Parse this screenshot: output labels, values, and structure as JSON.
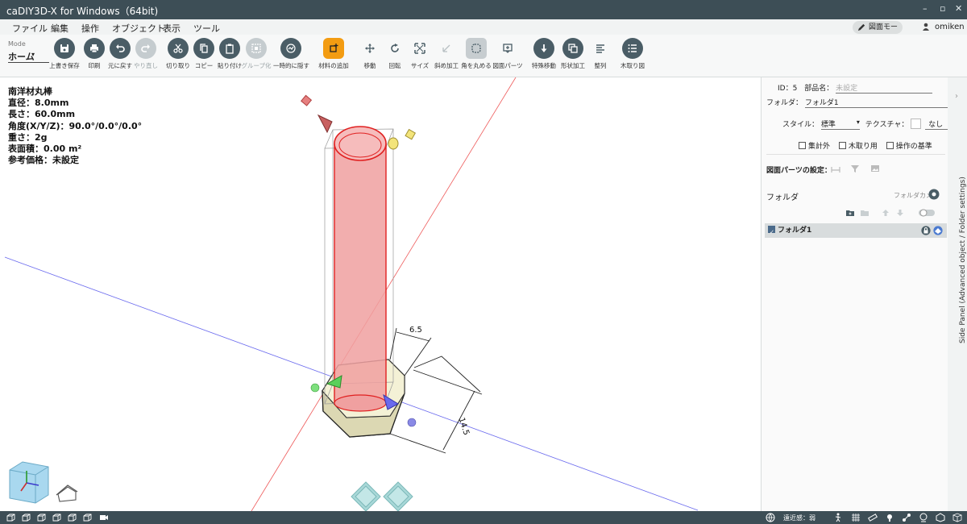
{
  "window": {
    "title": "caDIY3D-X for Windows（64bit)",
    "minimize": "–",
    "maximize": "▫",
    "close": "✕"
  },
  "menu": {
    "items": [
      "ファイル",
      "編集",
      "操作",
      "オブジェクト",
      "表示",
      "ツール"
    ]
  },
  "header_right": {
    "mode_button": "図面モード",
    "user": "omiken"
  },
  "toolbar": {
    "mode_label": "Mode",
    "mode_value": "ホーム",
    "tools": [
      {
        "label": "上書き保存",
        "icon": "save-icon",
        "enabled": true
      },
      {
        "label": "印刷",
        "icon": "print-icon",
        "enabled": true
      },
      {
        "label": "元に戻す",
        "icon": "undo-icon",
        "enabled": true
      },
      {
        "label": "やり直し",
        "icon": "redo-icon",
        "enabled": false
      },
      {
        "label": "切り取り",
        "icon": "cut-icon",
        "enabled": true
      },
      {
        "label": "コピー",
        "icon": "copy-icon",
        "enabled": true
      },
      {
        "label": "貼り付け",
        "icon": "paste-icon",
        "enabled": true
      },
      {
        "label": "グループ化",
        "icon": "group-icon",
        "enabled": false
      },
      {
        "label": "一時的に隠す",
        "icon": "hide-icon",
        "enabled": true
      },
      {
        "label": "材料の追加",
        "icon": "add-material-icon",
        "enabled": true
      },
      {
        "label": "移動",
        "icon": "move-icon",
        "enabled": true
      },
      {
        "label": "回転",
        "icon": "rotate-icon",
        "enabled": true
      },
      {
        "label": "サイズ",
        "icon": "resize-icon",
        "enabled": true
      },
      {
        "label": "斜め加工",
        "icon": "bevel-icon",
        "enabled": false
      },
      {
        "label": "角を丸める",
        "icon": "round-corner-icon",
        "enabled": true
      },
      {
        "label": "図面パーツ",
        "icon": "drawing-parts-icon",
        "enabled": true
      },
      {
        "label": "特殊移動",
        "icon": "special-move-icon",
        "enabled": true
      },
      {
        "label": "形状加工",
        "icon": "shape-process-icon",
        "enabled": true
      },
      {
        "label": "整列",
        "icon": "align-icon",
        "enabled": true
      },
      {
        "label": "木取り図",
        "icon": "cutting-list-icon",
        "enabled": true
      }
    ]
  },
  "info": {
    "name": "南洋材丸棒",
    "diameter": "直径：8.0mm",
    "length": "長さ：60.0mm",
    "angle": "角度(X/Y/Z)：90.0°/0.0°/0.0°",
    "weight": "重さ：2g",
    "surface": "表面積：0.00 m²",
    "price": "参考価格：未設定"
  },
  "dimensions": {
    "d1": "6.5",
    "d2": "14.5"
  },
  "side_panel": {
    "id_label": "ID：5",
    "part_name_label": "部品名：",
    "part_name_placeholder": "未設定",
    "folder_label": "フォルダ：",
    "folder_value": "フォルダ1",
    "style_label": "スタイル：",
    "style_value": "標準",
    "texture_label": "テクスチャ：",
    "texture_value": "なし",
    "checkboxes": [
      "集計外",
      "木取り用",
      "操作の基準"
    ],
    "drawing_parts_settings": "図面パーツの設定：",
    "folder_heading": "フォルダ",
    "folder_camera": "フォルダカメラ",
    "folders": [
      {
        "name": "フォルダ1",
        "checked": true
      }
    ],
    "vertical_tab": "Side Panel (Advanced object / Folder settings)"
  },
  "status": {
    "distance": "遠近感：弱"
  },
  "colors": {
    "titlebar": "#3d4e56",
    "tool_icon_bg": "#4a5d66",
    "accent_orange": "#f39c12",
    "rod_red": "#e04848",
    "base_cream": "#efeccb"
  }
}
